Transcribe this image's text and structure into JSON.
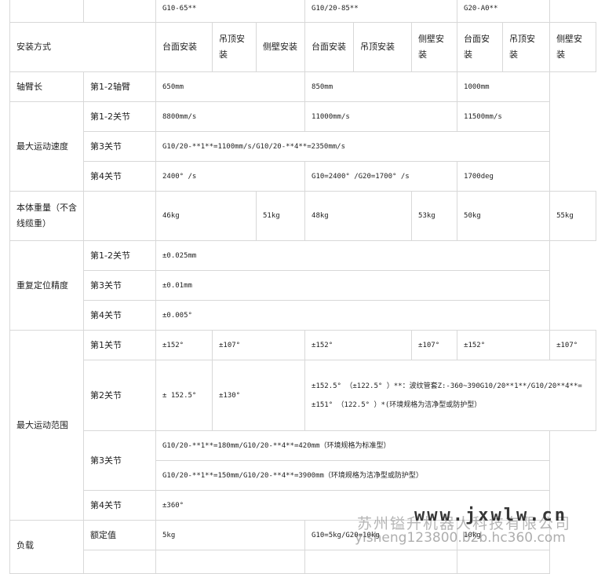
{
  "models": [
    "G10-65**",
    "G10/20-85**",
    "G20-A0**"
  ],
  "install": {
    "label": "安装方式",
    "options": [
      "台面安装",
      "吊顶安装",
      "侧壁安装",
      "台面安装",
      "吊顶安装",
      "侧壁安装",
      "台面安装",
      "吊顶安装",
      "侧壁安装"
    ]
  },
  "arm": {
    "label": "轴臂长",
    "sub": "第1-2轴臂",
    "values": [
      "650mm",
      "850mm",
      "1000mm"
    ]
  },
  "speed": {
    "label": "最大运动速度",
    "j12": {
      "sub": "第1-2关节",
      "values": [
        "8800mm/s",
        "11000mm/s",
        "11500mm/s"
      ]
    },
    "j3": {
      "sub": "第3关节",
      "value": "G10/20-**1**=1100mm/s/G10/20-**4**=2350mm/s"
    },
    "j4": {
      "sub": "第4关节",
      "values": [
        "2400° /s",
        "G10=2400° /G20=1700° /s",
        "1700deg"
      ]
    }
  },
  "weight": {
    "label": "本体重量（不含线缆重）",
    "values": [
      "46kg",
      "51kg",
      "48kg",
      "53kg",
      "50kg",
      "55kg"
    ]
  },
  "repeat": {
    "label": "重复定位精度",
    "j12": {
      "sub": "第1-2关节",
      "value": "±0.025mm"
    },
    "j3": {
      "sub": "第3关节",
      "value": "±0.01mm"
    },
    "j4": {
      "sub": "第4关节",
      "value": "±0.005°"
    }
  },
  "range": {
    "label": "最大运动范围",
    "j1": {
      "sub": "第1关节",
      "values": [
        "±152°",
        "±107°",
        "±152°",
        "±107°",
        "±152°",
        "±107°"
      ]
    },
    "j2": {
      "sub": "第2关节",
      "a": "± 152.5°",
      "b": "±130°",
      "c": "±152.5° （±122.5° ）**：波纹管套Z:-360~390G10/20**1**/G10/20**4**=±151° （122.5° ）*(环境规格为洁净型或防护型）"
    },
    "j3": {
      "sub": "第3关节",
      "line1": "G10/20-**1**=180mm/G10/20-**4**=420mm（环境规格为标准型）",
      "line2": "G10/20-**1**=150mm/G10/20-**4**=3900mm（环境规格为洁净型或防护型）"
    },
    "j4": {
      "sub": "第4关节",
      "value": "±360°"
    }
  },
  "load": {
    "label": "负载",
    "sub": "额定值",
    "values": [
      "5kg",
      "G10=5kg/G20=10kg",
      "10kg"
    ]
  },
  "watermark": {
    "company": "苏州镒升机器人科技有限公司",
    "site": "www.jxwlw.cn",
    "url": "yisheng123800.b2b.hc360.com"
  }
}
